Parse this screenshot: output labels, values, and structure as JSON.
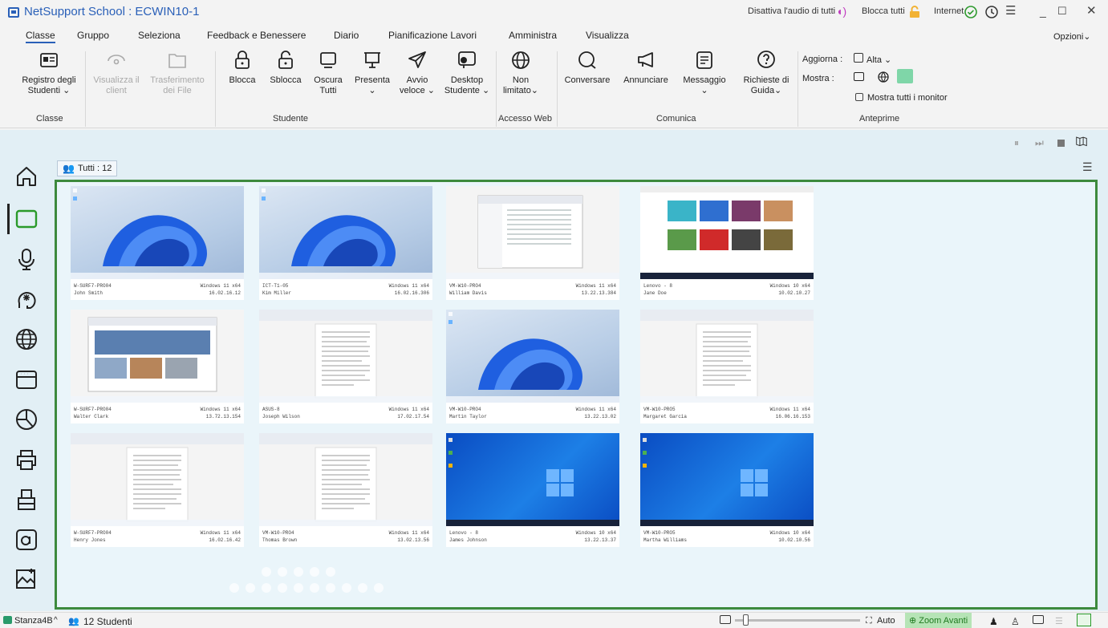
{
  "window": {
    "title": "NetSupport School : ECWIN10-1",
    "mute_all": "Disattiva l'audio di tutti",
    "lock_all": "Blocca tutti",
    "internet": "Internet",
    "options": "Opzioni"
  },
  "menu": {
    "tabs": [
      "Classe",
      "Gruppo",
      "Seleziona",
      "Feedback e Benessere",
      "Diario",
      "Pianificazione Lavori",
      "Amministra",
      "Visualizza"
    ]
  },
  "ribbon": {
    "buttons": [
      {
        "label": "Registro degli\nStudenti ⌄",
        "icon": "student-register-icon"
      },
      {
        "label": "Visualizza il\nclient",
        "icon": "view-client-icon"
      },
      {
        "label": "Trasferimento\ndei File",
        "icon": "file-transfer-icon"
      },
      {
        "label": "Blocca",
        "icon": "lock-icon"
      },
      {
        "label": "Sblocca",
        "icon": "unlock-icon"
      },
      {
        "label": "Oscura\nTutti",
        "icon": "blank-screen-icon"
      },
      {
        "label": "Presenta\n⌄",
        "icon": "present-icon"
      },
      {
        "label": "Avvio\nveloce ⌄",
        "icon": "quick-launch-icon"
      },
      {
        "label": "Desktop\nStudente ⌄",
        "icon": "student-desktop-icon"
      },
      {
        "label": "Non\nlimitato⌄",
        "icon": "web-globe-icon"
      },
      {
        "label": "Conversare",
        "icon": "chat-icon"
      },
      {
        "label": "Annunciare",
        "icon": "announce-icon"
      },
      {
        "label": "Messaggio\n⌄",
        "icon": "message-icon"
      },
      {
        "label": "Richieste di\nGuida⌄",
        "icon": "help-request-icon"
      }
    ],
    "groups": {
      "classe": "Classe",
      "studente": "Studente",
      "accesso_web": "Accesso Web",
      "comunica": "Comunica",
      "anteprime": "Anteprime"
    },
    "preview": {
      "refresh_label": "Aggiorna :",
      "refresh_value": "Alta",
      "show_label": "Mostra :",
      "show_all_monitors": "Mostra tutti i monitor"
    }
  },
  "content": {
    "group_chip": "Tutti : 12"
  },
  "students": [
    {
      "machine": "W-SURF7-PRO04",
      "name": "John Smith",
      "os": "Windows 11 x64",
      "ver": "16.02.16.12",
      "screen": "w11"
    },
    {
      "machine": "ICT-T1-05",
      "name": "Kim Miller",
      "os": "Windows 11 x64",
      "ver": "16.02.16.306",
      "screen": "w11"
    },
    {
      "machine": "VM-W10-PRO4",
      "name": "William Davis",
      "os": "Windows 11 x64",
      "ver": "13.22.13.384",
      "screen": "explorer"
    },
    {
      "machine": "Lenovo - 8",
      "name": "Jane Doe",
      "os": "Windows 10 x64",
      "ver": "10.02.10.27",
      "screen": "youtube"
    },
    {
      "machine": "W-SURF7-PRO04",
      "name": "Walter Clark",
      "os": "Windows 11 x64",
      "ver": "13.72.13.154",
      "screen": "browser"
    },
    {
      "machine": "ASUS-8",
      "name": "Joseph Wilson",
      "os": "Windows 11 x64",
      "ver": "17.02.17.54",
      "screen": "doc"
    },
    {
      "machine": "VM-W10-PRO4",
      "name": "Martin Taylor",
      "os": "Windows 11 x64",
      "ver": "13.22.13.02",
      "screen": "w11"
    },
    {
      "machine": "VM-W10-PRO5",
      "name": "Margaret Garcia",
      "os": "Windows 11 x64",
      "ver": "16.06.16.153",
      "screen": "doc"
    },
    {
      "machine": "W-SURF7-PRO04",
      "name": "Henry Jones",
      "os": "Windows 11 x64",
      "ver": "16.02.16.42",
      "screen": "doc"
    },
    {
      "machine": "VM-W10-PRO4",
      "name": "Thomas Brown",
      "os": "Windows 11 x64",
      "ver": "13.02.13.56",
      "screen": "doc"
    },
    {
      "machine": "Lenovo - 8",
      "name": "James Johnson",
      "os": "Windows 10 x64",
      "ver": "13.22.13.37",
      "screen": "w10"
    },
    {
      "machine": "VM-W10-PRO5",
      "name": "Martha Williams",
      "os": "Windows 10 x64",
      "ver": "10.02.10.56",
      "screen": "w10"
    }
  ],
  "status": {
    "room": "Stanza4B",
    "students": "12 Studenti",
    "auto": "Auto",
    "zoom": "Zoom Avanti"
  },
  "colors": {
    "brand": "#2a60b8",
    "selection_frame": "#3d8a3d",
    "content_bg": "#e2eff5"
  }
}
